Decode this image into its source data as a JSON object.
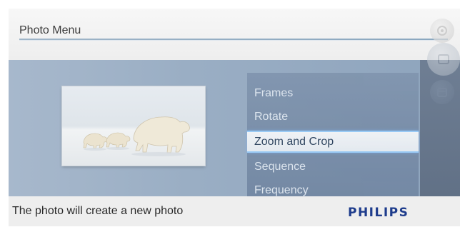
{
  "header": {
    "title": "Photo Menu"
  },
  "menu": {
    "items": [
      {
        "label": "Frames",
        "selected": false
      },
      {
        "label": "Rotate",
        "selected": false
      },
      {
        "label": "Zoom and Crop",
        "selected": true
      },
      {
        "label": "Sequence",
        "selected": false
      },
      {
        "label": "Frequency",
        "selected": false
      }
    ]
  },
  "preview": {
    "subject": "polar bears"
  },
  "rail": {
    "icons": [
      "photo-icon",
      "slideshow-icon",
      "calendar-icon"
    ]
  },
  "footer": {
    "status": "The photo will create a new photo",
    "brand": "PHILIPS"
  },
  "colors": {
    "menu_bg": "#7f93ad",
    "selected_bg": "#ffffff",
    "selected_border": "#9ad0ff",
    "brand": "#1e3c8c"
  }
}
